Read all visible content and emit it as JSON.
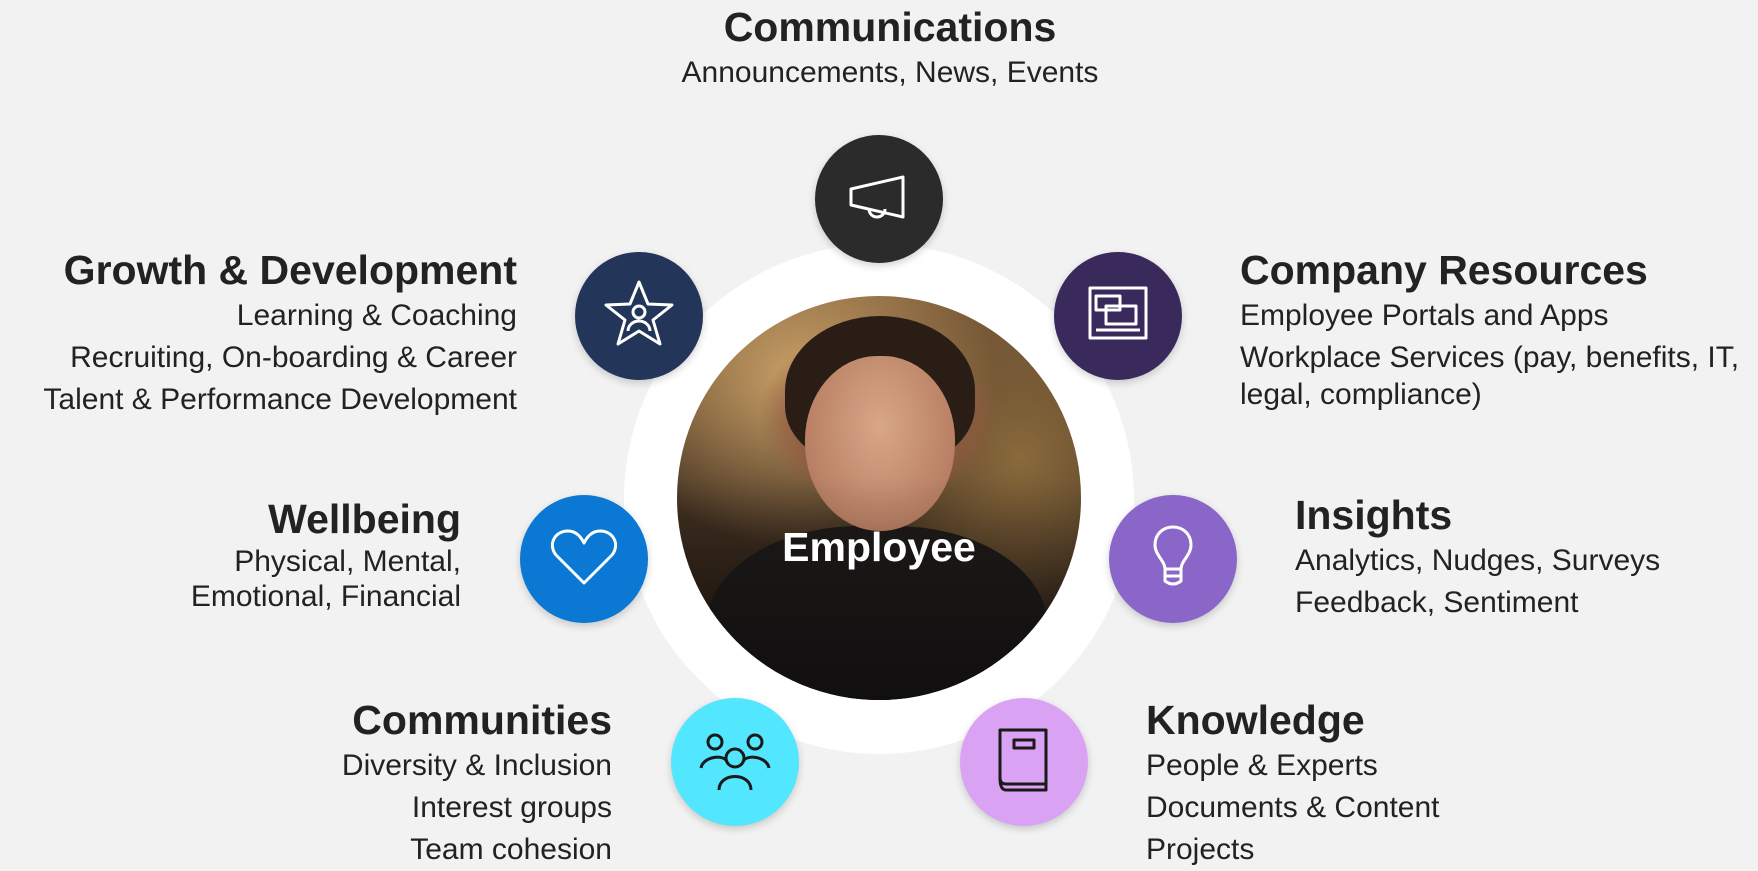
{
  "center": {
    "label": "Employee"
  },
  "colors": {
    "communications": "#2b2b2b",
    "growth": "#233559",
    "company_resources": "#3a2a5c",
    "wellbeing": "#0b78d4",
    "insights": "#8a66c8",
    "communities": "#52e6ff",
    "knowledge": "#d9a2f2"
  },
  "nodes": {
    "communications": {
      "icon": "megaphone-icon",
      "title": "Communications",
      "lines": [
        "Announcements, News, Events"
      ]
    },
    "growth": {
      "icon": "star-person-icon",
      "title": "Growth & Development",
      "lines": [
        "Learning & Coaching",
        "Recruiting, On-boarding & Career",
        "Talent & Performance Development"
      ]
    },
    "company_resources": {
      "icon": "windows-icon",
      "title": "Company Resources",
      "lines": [
        "Employee Portals and Apps",
        "Workplace Services (pay, benefits, IT,",
        "legal, compliance)"
      ]
    },
    "wellbeing": {
      "icon": "heart-icon",
      "title": "Wellbeing",
      "lines": [
        "Physical, Mental,",
        "Emotional, Financial"
      ]
    },
    "insights": {
      "icon": "lightbulb-icon",
      "title": "Insights",
      "lines": [
        "Analytics, Nudges, Surveys",
        "Feedback, Sentiment"
      ]
    },
    "communities": {
      "icon": "people-group-icon",
      "title": "Communities",
      "lines": [
        "Diversity & Inclusion",
        "Interest groups",
        "Team cohesion"
      ]
    },
    "knowledge": {
      "icon": "book-icon",
      "title": "Knowledge",
      "lines": [
        "People & Experts",
        "Documents & Content",
        "Projects"
      ]
    }
  }
}
